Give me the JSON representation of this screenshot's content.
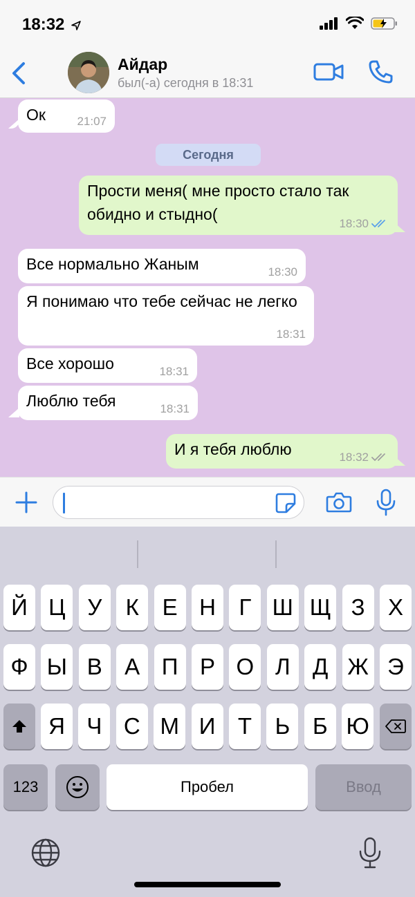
{
  "status_bar": {
    "time": "18:32"
  },
  "header": {
    "contact_name": "Айдар",
    "contact_status": "был(-а) сегодня в 18:31"
  },
  "chat": {
    "date_divider": "Сегодня",
    "messages": [
      {
        "direction": "in",
        "text": "Ок",
        "time": "21:07"
      },
      {
        "direction": "out",
        "text": "Прости меня( мне просто стало так обидно и стыдно(",
        "time": "18:30",
        "read": true
      },
      {
        "direction": "in",
        "text": "Все нормально Жаным",
        "time": "18:30"
      },
      {
        "direction": "in",
        "text": "Я понимаю что тебе сейчас не легко",
        "time": "18:31"
      },
      {
        "direction": "in",
        "text": "Все хорошо",
        "time": "18:31"
      },
      {
        "direction": "in",
        "text": "Люблю тебя",
        "time": "18:31"
      },
      {
        "direction": "out",
        "text": "И я тебя люблю",
        "time": "18:32",
        "read": false
      }
    ]
  },
  "input": {
    "value": ""
  },
  "keyboard": {
    "row1": [
      "Й",
      "Ц",
      "У",
      "К",
      "Е",
      "Н",
      "Г",
      "Ш",
      "Щ",
      "З",
      "Х"
    ],
    "row2": [
      "Ф",
      "Ы",
      "В",
      "А",
      "П",
      "Р",
      "О",
      "Л",
      "Д",
      "Ж",
      "Э"
    ],
    "row3": [
      "Я",
      "Ч",
      "С",
      "М",
      "И",
      "Т",
      "Ь",
      "Б",
      "Ю"
    ],
    "numbers_label": "123",
    "space_label": "Пробел",
    "return_label": "Ввод"
  },
  "colors": {
    "accent": "#2e7de0",
    "chat_background": "#dfc4e8",
    "outgoing_bubble": "#e1f7cb",
    "incoming_bubble": "#ffffff",
    "read_checks": "#5aa0ea"
  }
}
